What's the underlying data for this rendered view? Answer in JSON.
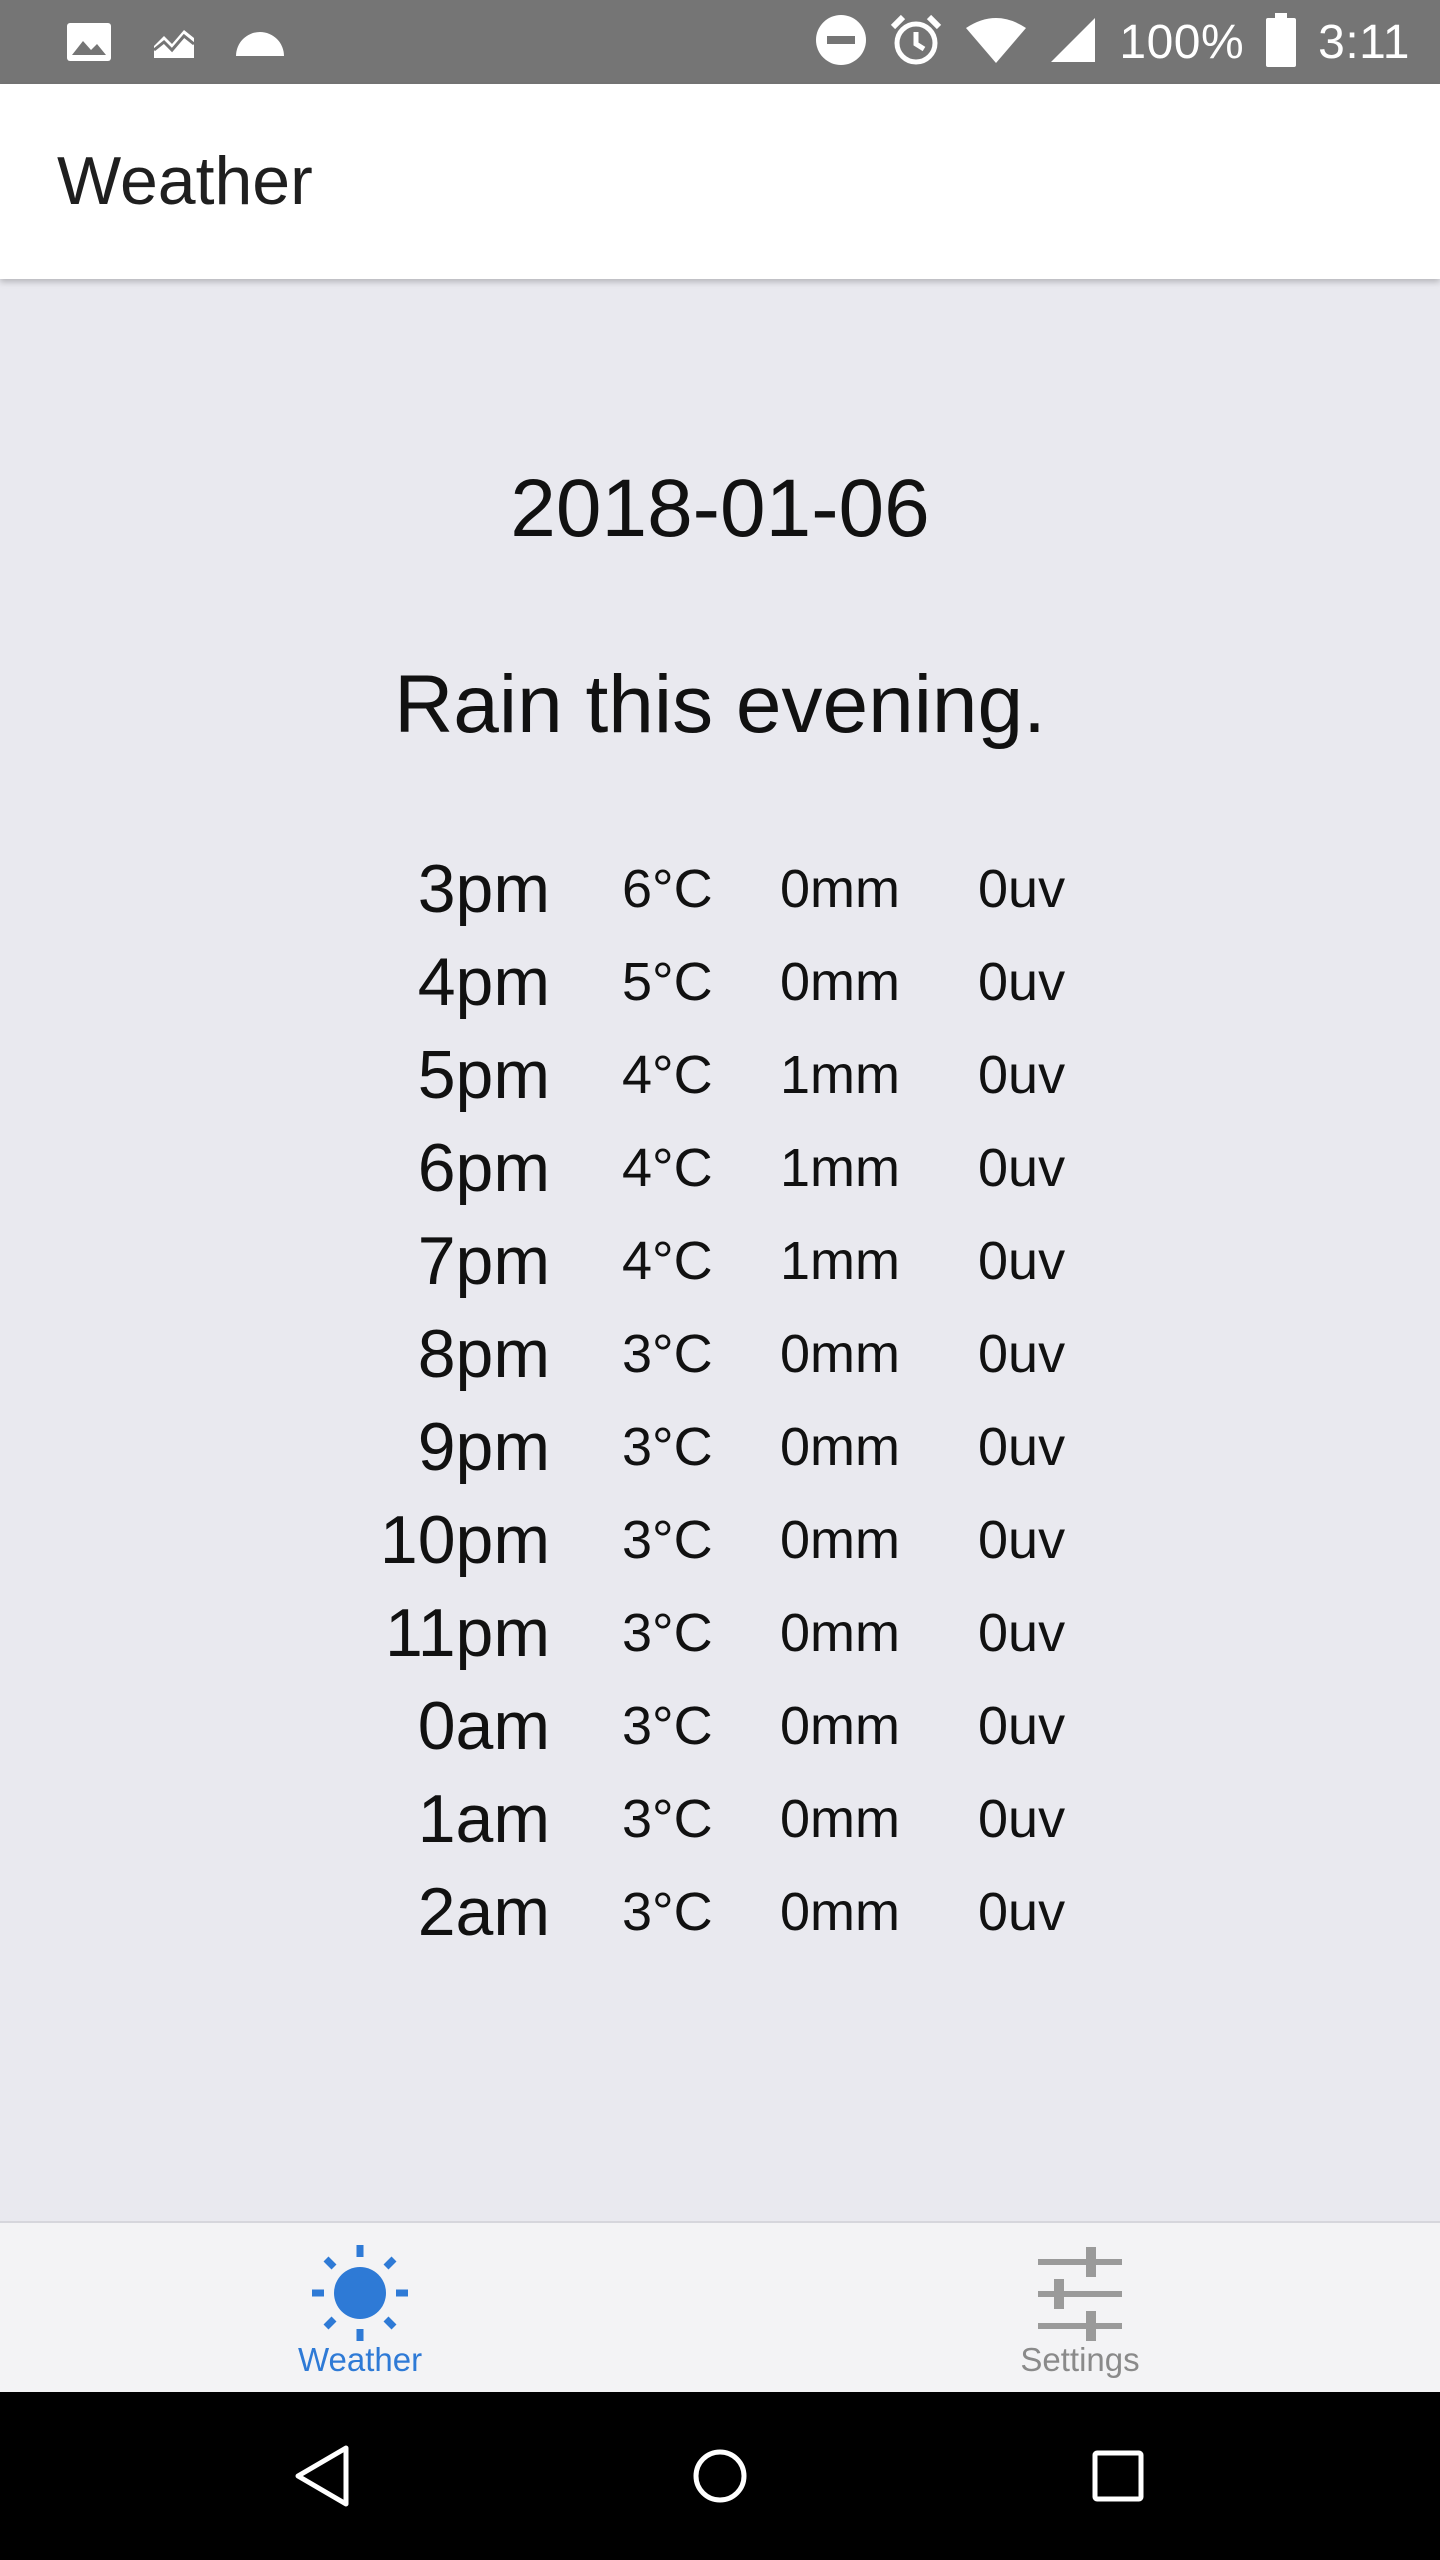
{
  "status_bar": {
    "battery": "100%",
    "time": "3:11",
    "left_icons": [
      "image-icon",
      "chart-icon",
      "cloud-icon"
    ],
    "right_icons": [
      "do-not-disturb-icon",
      "alarm-icon",
      "wifi-icon",
      "signal-icon",
      "battery-icon"
    ]
  },
  "app_bar": {
    "title": "Weather"
  },
  "main": {
    "date": "2018-01-06",
    "summary": "Rain this evening.",
    "forecast": [
      {
        "time": "3pm",
        "temp": "6°C",
        "precip": "0mm",
        "uv": "0uv"
      },
      {
        "time": "4pm",
        "temp": "5°C",
        "precip": "0mm",
        "uv": "0uv"
      },
      {
        "time": "5pm",
        "temp": "4°C",
        "precip": "1mm",
        "uv": "0uv"
      },
      {
        "time": "6pm",
        "temp": "4°C",
        "precip": "1mm",
        "uv": "0uv"
      },
      {
        "time": "7pm",
        "temp": "4°C",
        "precip": "1mm",
        "uv": "0uv"
      },
      {
        "time": "8pm",
        "temp": "3°C",
        "precip": "0mm",
        "uv": "0uv"
      },
      {
        "time": "9pm",
        "temp": "3°C",
        "precip": "0mm",
        "uv": "0uv"
      },
      {
        "time": "10pm",
        "temp": "3°C",
        "precip": "0mm",
        "uv": "0uv"
      },
      {
        "time": "11pm",
        "temp": "3°C",
        "precip": "0mm",
        "uv": "0uv"
      },
      {
        "time": "0am",
        "temp": "3°C",
        "precip": "0mm",
        "uv": "0uv"
      },
      {
        "time": "1am",
        "temp": "3°C",
        "precip": "0mm",
        "uv": "0uv"
      },
      {
        "time": "2am",
        "temp": "3°C",
        "precip": "0mm",
        "uv": "0uv"
      }
    ]
  },
  "bottom_nav": {
    "items": [
      {
        "label": "Weather",
        "icon": "sun-icon",
        "active": true
      },
      {
        "label": "Settings",
        "icon": "sliders-icon",
        "active": false
      }
    ]
  },
  "system_nav": {
    "buttons": [
      "back-icon",
      "home-icon",
      "recents-icon"
    ]
  },
  "colors": {
    "status_bar": "#757575",
    "background": "#e9e9ef",
    "accent": "#2e7ad6",
    "inactive": "#8a8a8a"
  }
}
